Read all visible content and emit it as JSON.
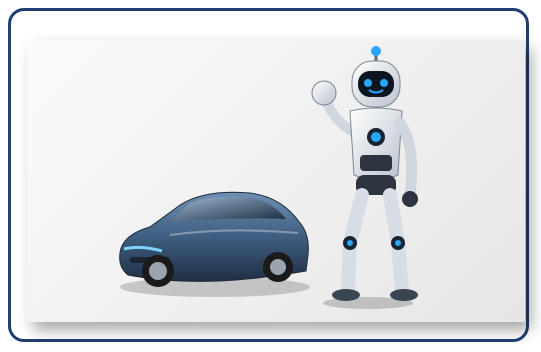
{
  "scene": {
    "objects": [
      "car-illustration",
      "robot-illustration"
    ],
    "colors": {
      "frame_border": "#1f3f73",
      "panel_bg": "#f1f1f1",
      "car_body": "#3f5e80",
      "robot_body": "#e9edf2",
      "robot_glow": "#2aa6ff"
    }
  }
}
